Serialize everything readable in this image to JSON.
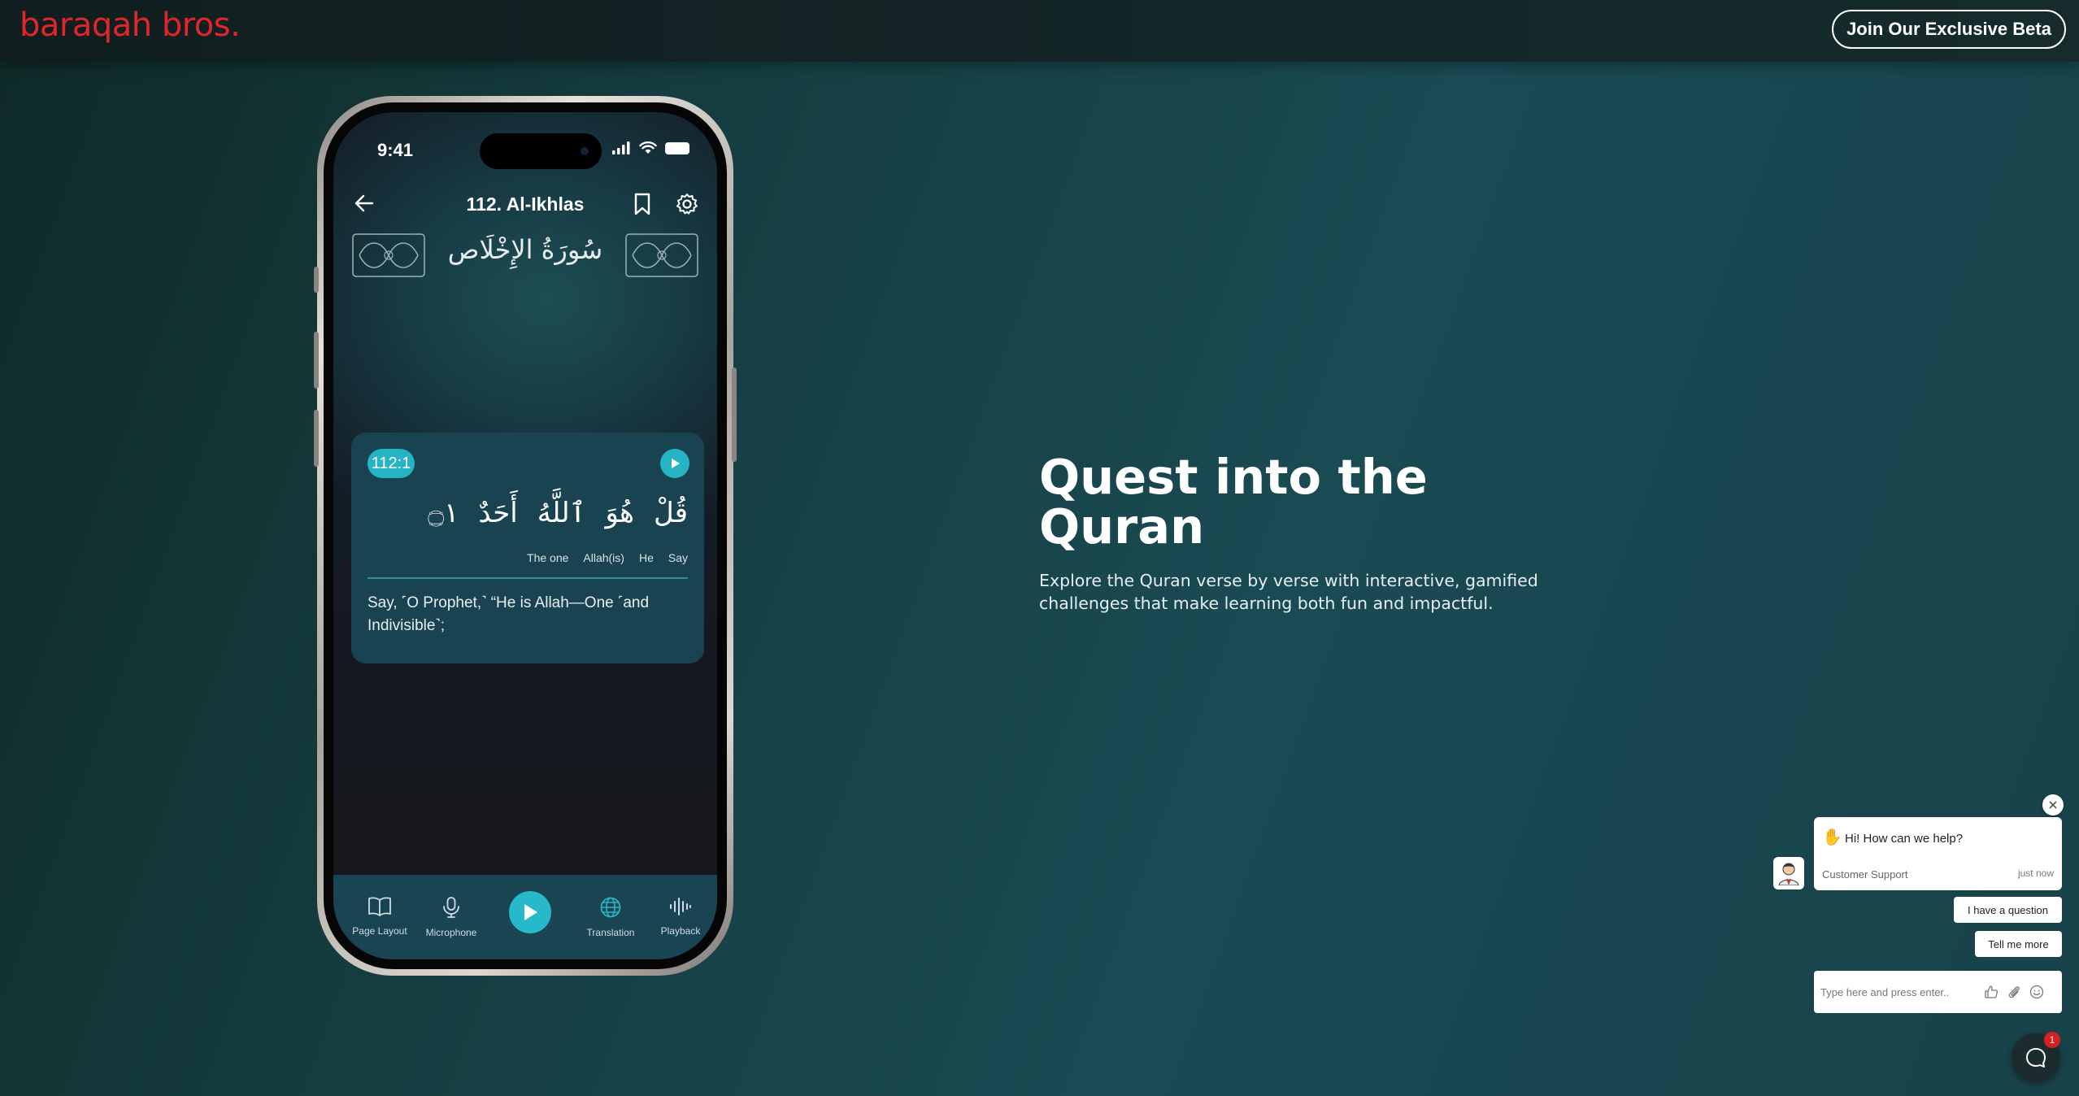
{
  "header": {
    "logo": "baraqah bros.",
    "cta_label": "Join Our Exclusive Beta"
  },
  "phone": {
    "status_time": "9:41",
    "surah_title": "112. Al-Ikhlas",
    "arabic_title": "سُورَةُ الإِخْلَاص",
    "verse": {
      "badge": "112:1",
      "arabic_words": [
        "قُلْ",
        "هُوَ",
        "ٱللَّهُ",
        "أَحَدٌ",
        "۝١"
      ],
      "glosses": [
        "The one",
        "Allah(is)",
        "He",
        "Say"
      ],
      "translation": "Say, ˹O Prophet,˺ “He is Allah—One ˹and Indivisible˺;"
    },
    "tabs": [
      {
        "label": "Page Layout",
        "icon": "book-icon"
      },
      {
        "label": "Microphone",
        "icon": "microphone-icon"
      },
      {
        "label": "Translation",
        "icon": "globe-icon"
      },
      {
        "label": "Playback",
        "icon": "waveform-icon"
      }
    ]
  },
  "hero": {
    "title": "Quest into the Quran",
    "subtitle": "Explore the Quran verse by verse with interactive, gamified challenges that make learning both fun and impactful."
  },
  "chat": {
    "greeting": "Hi! How can we help?",
    "agent": "Customer Support",
    "time": "just now",
    "quick_replies": [
      "I have a question",
      "Tell me more"
    ],
    "input_placeholder": "Type here and press enter..",
    "badge_count": "1"
  },
  "colors": {
    "accent": "#26b4c4",
    "logo_red": "#e0262b",
    "background": "#1a4a52"
  }
}
